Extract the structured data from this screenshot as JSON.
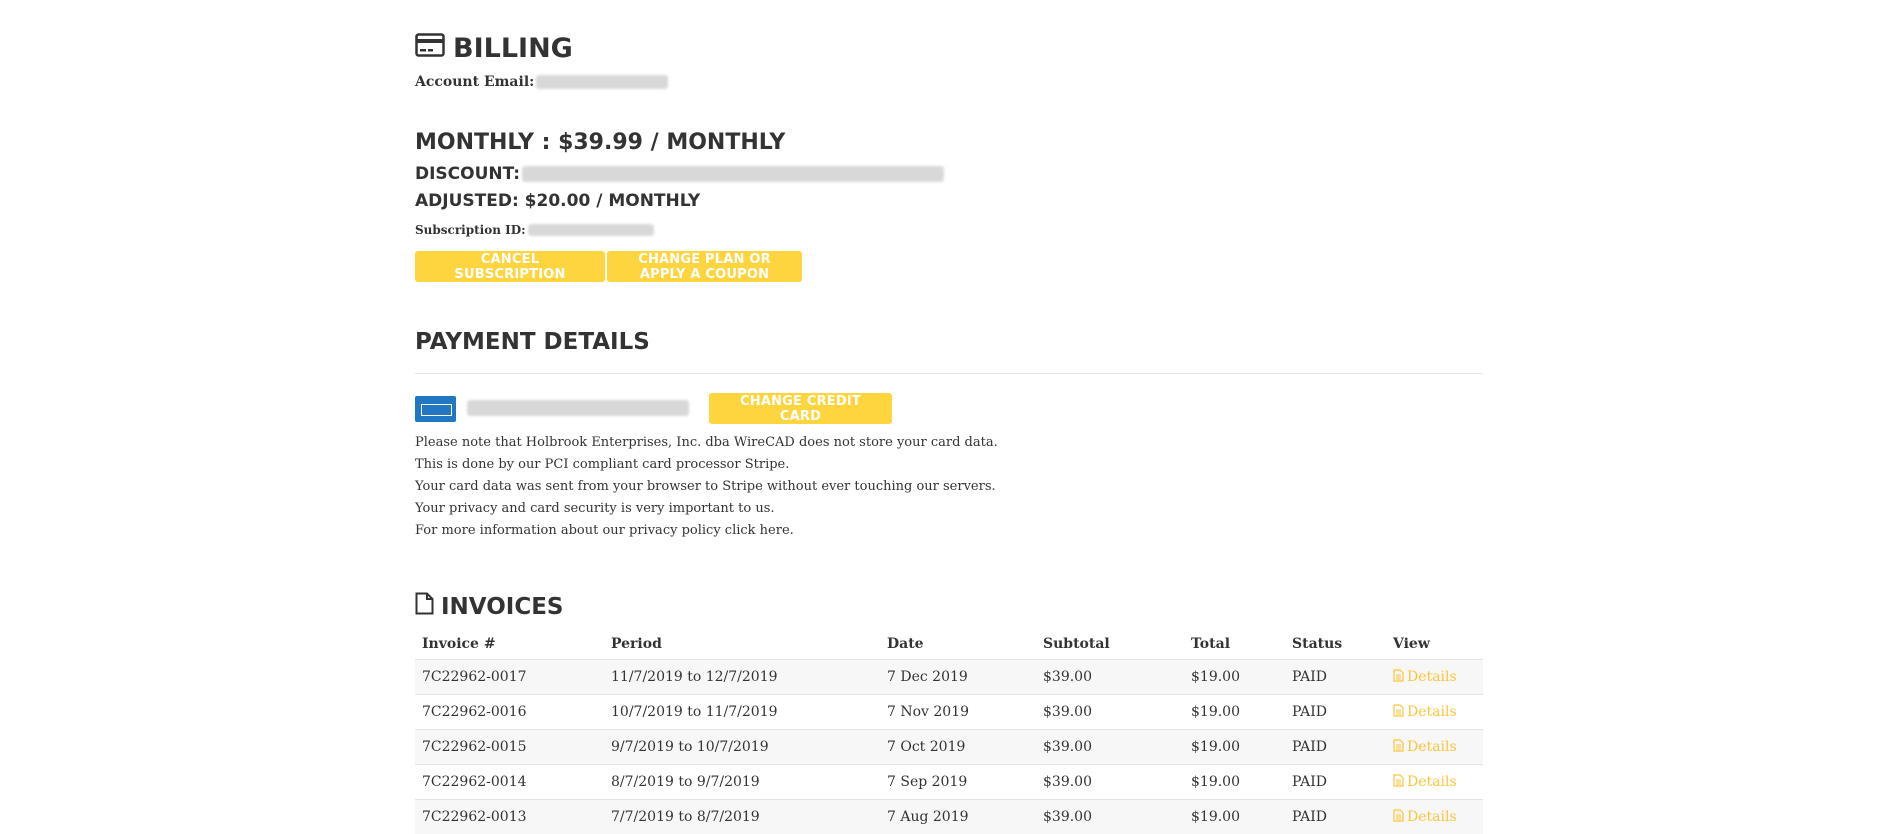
{
  "billing": {
    "title": "BILLING",
    "account_email_label": "Account Email:"
  },
  "plan": {
    "monthly": "MONTHLY : $39.99 / MONTHLY",
    "discount_label": "DISCOUNT:",
    "adjusted": "ADJUSTED: $20.00 / MONTHLY",
    "subscription_id_label": "Subscription ID:"
  },
  "buttons": {
    "cancel": "CANCEL SUBSCRIPTION",
    "change_plan": "CHANGE PLAN OR APPLY A COUPON",
    "change_card": "CHANGE CREDIT CARD"
  },
  "payment": {
    "title": "PAYMENT DETAILS",
    "notice": [
      "Please note that Holbrook Enterprises, Inc. dba WireCAD does not store your card data.",
      "This is done by our PCI compliant card processor Stripe.",
      "Your card data was sent from your browser to Stripe without ever touching our servers.",
      "Your privacy and card security is very important to us.",
      "For more information about our privacy policy click here."
    ]
  },
  "invoices": {
    "title": "INVOICES",
    "columns": [
      "Invoice #",
      "Period",
      "Date",
      "Subtotal",
      "Total",
      "Status",
      "View"
    ],
    "rows": [
      {
        "invoice": "7C22962-0017",
        "period": "11/7/2019 to 12/7/2019",
        "date": "7 Dec 2019",
        "subtotal": "$39.00",
        "total": "$19.00",
        "status": "PAID",
        "view": "Details"
      },
      {
        "invoice": "7C22962-0016",
        "period": "10/7/2019 to 11/7/2019",
        "date": "7 Nov 2019",
        "subtotal": "$39.00",
        "total": "$19.00",
        "status": "PAID",
        "view": "Details"
      },
      {
        "invoice": "7C22962-0015",
        "period": "9/7/2019 to 10/7/2019",
        "date": "7 Oct 2019",
        "subtotal": "$39.00",
        "total": "$19.00",
        "status": "PAID",
        "view": "Details"
      },
      {
        "invoice": "7C22962-0014",
        "period": "8/7/2019 to 9/7/2019",
        "date": "7 Sep 2019",
        "subtotal": "$39.00",
        "total": "$19.00",
        "status": "PAID",
        "view": "Details"
      },
      {
        "invoice": "7C22962-0013",
        "period": "7/7/2019 to 8/7/2019",
        "date": "7 Aug 2019",
        "subtotal": "$39.00",
        "total": "$19.00",
        "status": "PAID",
        "view": "Details"
      }
    ]
  },
  "colors": {
    "accent": "#fed53e",
    "link": "#fcc63a",
    "amex": "#2277c3",
    "text": "#333333"
  },
  "icons": {
    "billing": "credit-card-icon",
    "invoices": "file-icon",
    "details": "file-text-icon",
    "card_brand": "amex-card-icon"
  }
}
